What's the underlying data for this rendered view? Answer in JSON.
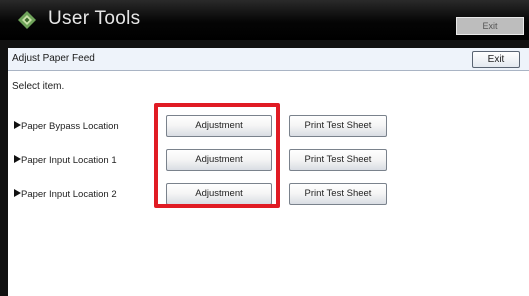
{
  "titlebar": {
    "title": "User Tools",
    "exit_label": "Exit"
  },
  "panel": {
    "title": "Adjust Paper Feed",
    "exit_label": "Exit",
    "instruction": "Select item.",
    "rows": [
      {
        "label": "Paper Bypass Location",
        "adjust_label": "Adjustment",
        "print_label": "Print Test Sheet"
      },
      {
        "label": "Paper Input Location 1",
        "adjust_label": "Adjustment",
        "print_label": "Print Test Sheet"
      },
      {
        "label": "Paper Input Location 2",
        "adjust_label": "Adjustment",
        "print_label": "Print Test Sheet"
      }
    ]
  },
  "colors": {
    "highlight": "#e01b24",
    "titlebar": "#000000",
    "panel_header": "#eef3fa"
  },
  "icons": {
    "title_icon": "user-tools-diamond-icon",
    "row_marker": "right-triangle-icon"
  }
}
